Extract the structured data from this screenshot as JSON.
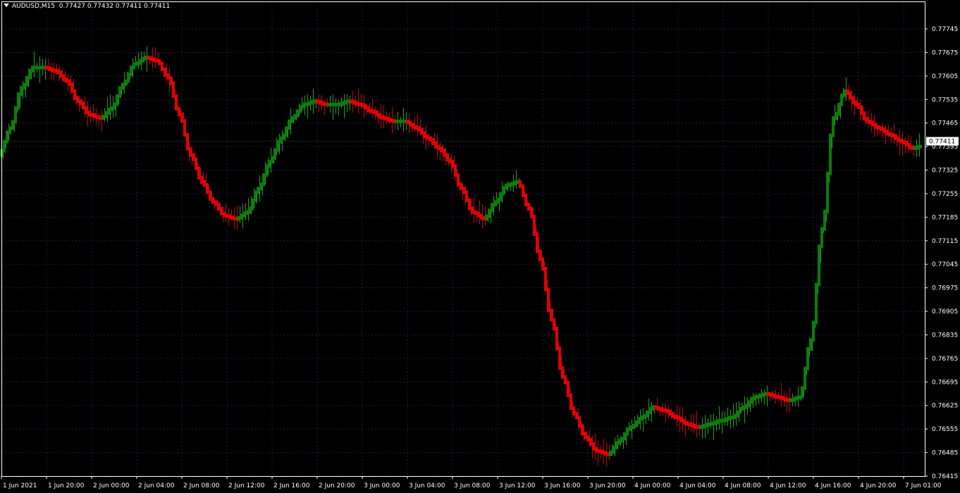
{
  "header": {
    "symbol": "AUDUSD,M15",
    "open": "0.77427",
    "high": "0.77432",
    "low": "0.77411",
    "close": "0.77411"
  },
  "price_tag": "0.77411",
  "colors": {
    "background": "#000000",
    "frame": "#ffffff",
    "grid": "#1e1e46",
    "bull": "#0a7d0a",
    "bear": "#e00000",
    "bull_bar": "#2a9c2a",
    "bear_bar": "#b01010"
  },
  "chart_data": {
    "type": "line",
    "title": "",
    "ylim": [
      0.76415,
      0.7781
    ],
    "y_ticks": [
      "0.77745",
      "0.77675",
      "0.77605",
      "0.77535",
      "0.77465",
      "0.77395",
      "0.77325",
      "0.77255",
      "0.77185",
      "0.77115",
      "0.77045",
      "0.76975",
      "0.76905",
      "0.76835",
      "0.76765",
      "0.76695",
      "0.76625",
      "0.76555",
      "0.76485",
      "0.76415"
    ],
    "x_ticks": [
      "1 Jun 2021",
      "1 Jun 20:00",
      "2 Jun 00:00",
      "2 Jun 04:00",
      "2 Jun 08:00",
      "2 Jun 12:00",
      "2 Jun 16:00",
      "2 Jun 20:00",
      "3 Jun 00:00",
      "3 Jun 04:00",
      "3 Jun 08:00",
      "3 Jun 12:00",
      "3 Jun 16:00",
      "3 Jun 20:00",
      "4 Jun 00:00",
      "4 Jun 04:00",
      "4 Jun 08:00",
      "4 Jun 12:00",
      "4 Jun 16:00",
      "4 Jun 20:00",
      "7 Jun 01:00"
    ],
    "series": [
      {
        "values": [
          [
            0,
            0.7737
          ],
          [
            16,
            0.7745
          ],
          [
            32,
            0.7757
          ],
          [
            48,
            0.7763
          ],
          [
            64,
            0.7763
          ],
          [
            80,
            0.7762
          ],
          [
            96,
            0.7759
          ],
          [
            112,
            0.7753
          ],
          [
            128,
            0.7749
          ],
          [
            144,
            0.7748
          ],
          [
            160,
            0.7751
          ],
          [
            176,
            0.7758
          ],
          [
            192,
            0.7764
          ],
          [
            208,
            0.7766
          ],
          [
            224,
            0.7765
          ],
          [
            240,
            0.776
          ],
          [
            256,
            0.7749
          ],
          [
            272,
            0.7737
          ],
          [
            288,
            0.7729
          ],
          [
            304,
            0.7723
          ],
          [
            320,
            0.7719
          ],
          [
            336,
            0.7718
          ],
          [
            352,
            0.772
          ],
          [
            368,
            0.7727
          ],
          [
            384,
            0.7735
          ],
          [
            400,
            0.7742
          ],
          [
            416,
            0.7748
          ],
          [
            432,
            0.7752
          ],
          [
            448,
            0.7753
          ],
          [
            464,
            0.7752
          ],
          [
            480,
            0.7752
          ],
          [
            496,
            0.7753
          ],
          [
            512,
            0.7752
          ],
          [
            528,
            0.775
          ],
          [
            544,
            0.7748
          ],
          [
            560,
            0.7747
          ],
          [
            576,
            0.7747
          ],
          [
            592,
            0.7745
          ],
          [
            608,
            0.7742
          ],
          [
            624,
            0.7739
          ],
          [
            640,
            0.7735
          ],
          [
            656,
            0.7727
          ],
          [
            672,
            0.772
          ],
          [
            688,
            0.7718
          ],
          [
            704,
            0.7723
          ],
          [
            720,
            0.7728
          ],
          [
            736,
            0.7729
          ],
          [
            752,
            0.7721
          ],
          [
            768,
            0.7706
          ],
          [
            784,
            0.7688
          ],
          [
            800,
            0.7671
          ],
          [
            816,
            0.766
          ],
          [
            832,
            0.7653
          ],
          [
            848,
            0.7649
          ],
          [
            864,
            0.7648
          ],
          [
            880,
            0.7652
          ],
          [
            896,
            0.7656
          ],
          [
            912,
            0.7659
          ],
          [
            928,
            0.7662
          ],
          [
            944,
            0.7661
          ],
          [
            960,
            0.7659
          ],
          [
            976,
            0.7657
          ],
          [
            992,
            0.7656
          ],
          [
            1008,
            0.7657
          ],
          [
            1024,
            0.7658
          ],
          [
            1040,
            0.7659
          ],
          [
            1056,
            0.7662
          ],
          [
            1072,
            0.7665
          ],
          [
            1088,
            0.7666
          ],
          [
            1104,
            0.7665
          ],
          [
            1120,
            0.7664
          ],
          [
            1136,
            0.7665
          ],
          [
            1152,
            0.7682
          ],
          [
            1168,
            0.7715
          ],
          [
            1184,
            0.7748
          ],
          [
            1200,
            0.7756
          ],
          [
            1216,
            0.7752
          ],
          [
            1232,
            0.7747
          ],
          [
            1248,
            0.7745
          ],
          [
            1264,
            0.7743
          ],
          [
            1280,
            0.7741
          ],
          [
            1296,
            0.7739
          ],
          [
            1306,
            0.77395
          ]
        ]
      }
    ]
  }
}
